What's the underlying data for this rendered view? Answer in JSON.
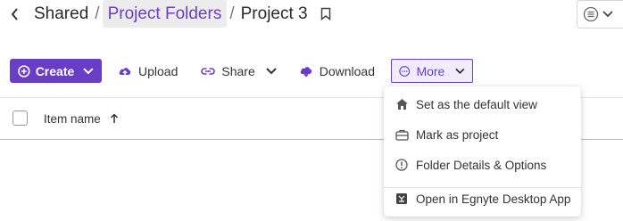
{
  "breadcrumb": {
    "root": "Shared",
    "parent": "Project Folders",
    "current": "Project 3",
    "separator": "/"
  },
  "toolbar": {
    "create_label": "Create",
    "upload_label": "Upload",
    "share_label": "Share",
    "download_label": "Download",
    "more_label": "More"
  },
  "table": {
    "column_name": "Item name"
  },
  "more_menu": {
    "items": [
      {
        "label": "Set as the default view",
        "icon": "home-icon"
      },
      {
        "label": "Mark as project",
        "icon": "briefcase-icon"
      },
      {
        "label": "Folder Details & Options",
        "icon": "info-icon"
      },
      {
        "label": "Open in Egnyte Desktop App",
        "icon": "desktop-app-icon"
      }
    ]
  },
  "colors": {
    "accent": "#6a3dc6",
    "accent_bg": "#f1ecfb"
  }
}
